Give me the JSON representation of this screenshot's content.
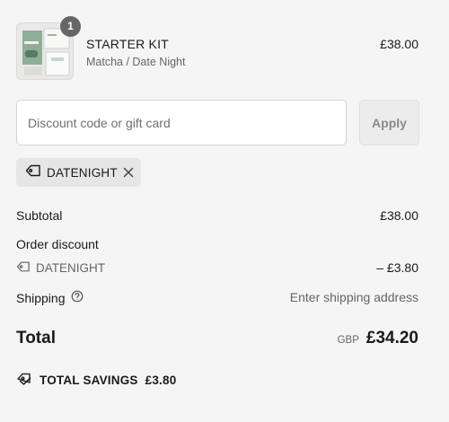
{
  "line_item": {
    "quantity": "1",
    "title": "STARTER KIT",
    "variant": "Matcha / Date Night",
    "price": "£38.00"
  },
  "discount": {
    "placeholder": "Discount code or gift card",
    "value": "",
    "apply_label": "Apply",
    "applied_code": "DATENIGHT"
  },
  "summary": {
    "subtotal_label": "Subtotal",
    "subtotal_value": "£38.00",
    "order_discount_label": "Order discount",
    "discount_code": "DATENIGHT",
    "discount_value": "– £3.80",
    "shipping_label": "Shipping",
    "shipping_value": "Enter shipping address",
    "total_label": "Total",
    "currency": "GBP",
    "total_value": "£34.20",
    "savings_label": "TOTAL SAVINGS",
    "savings_value": "£3.80"
  },
  "icons": {
    "tag": "tag-icon",
    "close": "close-icon",
    "help": "question-circle-icon",
    "savings_tag": "double-tag-icon"
  }
}
